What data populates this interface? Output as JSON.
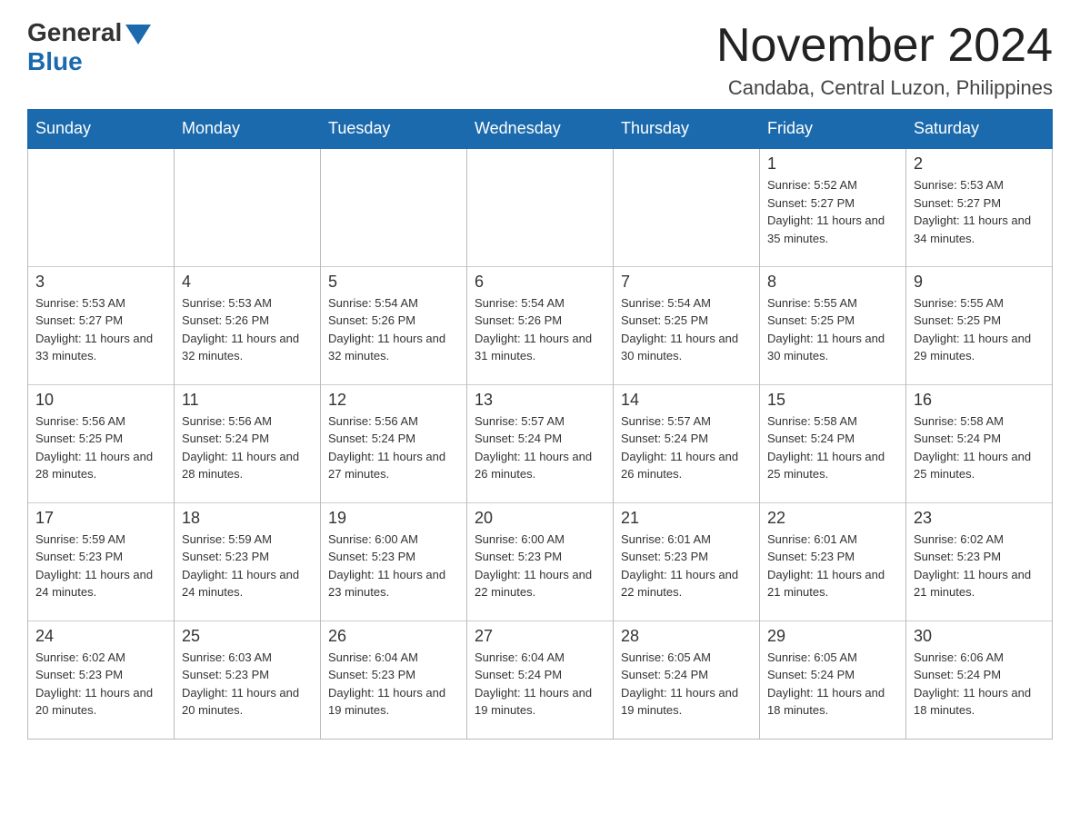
{
  "logo": {
    "general": "General",
    "blue": "Blue"
  },
  "title": {
    "month": "November 2024",
    "location": "Candaba, Central Luzon, Philippines"
  },
  "weekdays": [
    "Sunday",
    "Monday",
    "Tuesday",
    "Wednesday",
    "Thursday",
    "Friday",
    "Saturday"
  ],
  "weeks": [
    [
      {
        "day": "",
        "info": ""
      },
      {
        "day": "",
        "info": ""
      },
      {
        "day": "",
        "info": ""
      },
      {
        "day": "",
        "info": ""
      },
      {
        "day": "",
        "info": ""
      },
      {
        "day": "1",
        "info": "Sunrise: 5:52 AM\nSunset: 5:27 PM\nDaylight: 11 hours and 35 minutes."
      },
      {
        "day": "2",
        "info": "Sunrise: 5:53 AM\nSunset: 5:27 PM\nDaylight: 11 hours and 34 minutes."
      }
    ],
    [
      {
        "day": "3",
        "info": "Sunrise: 5:53 AM\nSunset: 5:27 PM\nDaylight: 11 hours and 33 minutes."
      },
      {
        "day": "4",
        "info": "Sunrise: 5:53 AM\nSunset: 5:26 PM\nDaylight: 11 hours and 32 minutes."
      },
      {
        "day": "5",
        "info": "Sunrise: 5:54 AM\nSunset: 5:26 PM\nDaylight: 11 hours and 32 minutes."
      },
      {
        "day": "6",
        "info": "Sunrise: 5:54 AM\nSunset: 5:26 PM\nDaylight: 11 hours and 31 minutes."
      },
      {
        "day": "7",
        "info": "Sunrise: 5:54 AM\nSunset: 5:25 PM\nDaylight: 11 hours and 30 minutes."
      },
      {
        "day": "8",
        "info": "Sunrise: 5:55 AM\nSunset: 5:25 PM\nDaylight: 11 hours and 30 minutes."
      },
      {
        "day": "9",
        "info": "Sunrise: 5:55 AM\nSunset: 5:25 PM\nDaylight: 11 hours and 29 minutes."
      }
    ],
    [
      {
        "day": "10",
        "info": "Sunrise: 5:56 AM\nSunset: 5:25 PM\nDaylight: 11 hours and 28 minutes."
      },
      {
        "day": "11",
        "info": "Sunrise: 5:56 AM\nSunset: 5:24 PM\nDaylight: 11 hours and 28 minutes."
      },
      {
        "day": "12",
        "info": "Sunrise: 5:56 AM\nSunset: 5:24 PM\nDaylight: 11 hours and 27 minutes."
      },
      {
        "day": "13",
        "info": "Sunrise: 5:57 AM\nSunset: 5:24 PM\nDaylight: 11 hours and 26 minutes."
      },
      {
        "day": "14",
        "info": "Sunrise: 5:57 AM\nSunset: 5:24 PM\nDaylight: 11 hours and 26 minutes."
      },
      {
        "day": "15",
        "info": "Sunrise: 5:58 AM\nSunset: 5:24 PM\nDaylight: 11 hours and 25 minutes."
      },
      {
        "day": "16",
        "info": "Sunrise: 5:58 AM\nSunset: 5:24 PM\nDaylight: 11 hours and 25 minutes."
      }
    ],
    [
      {
        "day": "17",
        "info": "Sunrise: 5:59 AM\nSunset: 5:23 PM\nDaylight: 11 hours and 24 minutes."
      },
      {
        "day": "18",
        "info": "Sunrise: 5:59 AM\nSunset: 5:23 PM\nDaylight: 11 hours and 24 minutes."
      },
      {
        "day": "19",
        "info": "Sunrise: 6:00 AM\nSunset: 5:23 PM\nDaylight: 11 hours and 23 minutes."
      },
      {
        "day": "20",
        "info": "Sunrise: 6:00 AM\nSunset: 5:23 PM\nDaylight: 11 hours and 22 minutes."
      },
      {
        "day": "21",
        "info": "Sunrise: 6:01 AM\nSunset: 5:23 PM\nDaylight: 11 hours and 22 minutes."
      },
      {
        "day": "22",
        "info": "Sunrise: 6:01 AM\nSunset: 5:23 PM\nDaylight: 11 hours and 21 minutes."
      },
      {
        "day": "23",
        "info": "Sunrise: 6:02 AM\nSunset: 5:23 PM\nDaylight: 11 hours and 21 minutes."
      }
    ],
    [
      {
        "day": "24",
        "info": "Sunrise: 6:02 AM\nSunset: 5:23 PM\nDaylight: 11 hours and 20 minutes."
      },
      {
        "day": "25",
        "info": "Sunrise: 6:03 AM\nSunset: 5:23 PM\nDaylight: 11 hours and 20 minutes."
      },
      {
        "day": "26",
        "info": "Sunrise: 6:04 AM\nSunset: 5:23 PM\nDaylight: 11 hours and 19 minutes."
      },
      {
        "day": "27",
        "info": "Sunrise: 6:04 AM\nSunset: 5:24 PM\nDaylight: 11 hours and 19 minutes."
      },
      {
        "day": "28",
        "info": "Sunrise: 6:05 AM\nSunset: 5:24 PM\nDaylight: 11 hours and 19 minutes."
      },
      {
        "day": "29",
        "info": "Sunrise: 6:05 AM\nSunset: 5:24 PM\nDaylight: 11 hours and 18 minutes."
      },
      {
        "day": "30",
        "info": "Sunrise: 6:06 AM\nSunset: 5:24 PM\nDaylight: 11 hours and 18 minutes."
      }
    ]
  ]
}
